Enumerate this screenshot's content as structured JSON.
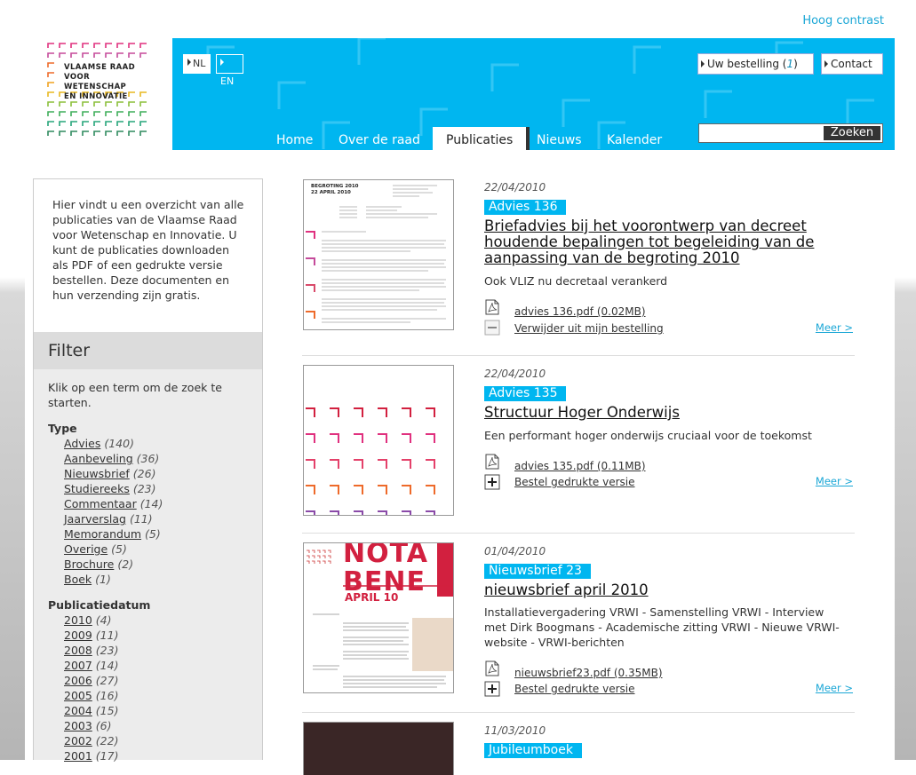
{
  "header": {
    "high_contrast": "Hoog contrast",
    "logo_lines": [
      "VLAAMSE RAAD",
      "VOOR WETENSCHAP",
      "EN INNOVATIE"
    ],
    "lang_nl": "NL",
    "lang_en": "EN",
    "order_label": "Uw bestelling (",
    "order_count": "1",
    "order_close": ")",
    "contact_label": "Contact",
    "nav": [
      "Home",
      "Over de raad",
      "Publicaties",
      "Nieuws",
      "Kalender"
    ],
    "search_button": "Zoeken",
    "search_value": ""
  },
  "sidebar": {
    "intro": "Hier vindt u een overzicht van alle publicaties van de Vlaamse Raad voor Wetenschap en Innovatie. U kunt de publicaties downloaden als PDF of een gedrukte versie bestellen. Deze documenten en hun verzending zijn gratis.",
    "filter_title": "Filter",
    "filter_intro": "Klik op een term om de zoek te starten.",
    "type_title": "Type",
    "types": [
      {
        "label": "Advies",
        "count": "(140)"
      },
      {
        "label": "Aanbeveling",
        "count": "(36)"
      },
      {
        "label": "Nieuwsbrief",
        "count": "(26)"
      },
      {
        "label": "Studiereeks",
        "count": "(23)"
      },
      {
        "label": "Commentaar",
        "count": "(14)"
      },
      {
        "label": "Jaarverslag",
        "count": "(11)"
      },
      {
        "label": "Memorandum",
        "count": "(5)"
      },
      {
        "label": "Overige",
        "count": "(5)"
      },
      {
        "label": "Brochure",
        "count": "(2)"
      },
      {
        "label": "Boek",
        "count": "(1)"
      }
    ],
    "date_title": "Publicatiedatum",
    "dates": [
      {
        "label": "2010",
        "count": "(4)"
      },
      {
        "label": "2009",
        "count": "(11)"
      },
      {
        "label": "2008",
        "count": "(23)"
      },
      {
        "label": "2007",
        "count": "(14)"
      },
      {
        "label": "2006",
        "count": "(27)"
      },
      {
        "label": "2005",
        "count": "(16)"
      },
      {
        "label": "2004",
        "count": "(15)"
      },
      {
        "label": "2003",
        "count": "(6)"
      },
      {
        "label": "2002",
        "count": "(22)"
      },
      {
        "label": "2001",
        "count": "(17)"
      }
    ]
  },
  "publications": [
    {
      "date": "22/04/2010",
      "badge": "Advies 136",
      "title": "Briefadvies bij het voorontwerp van decreet houdende bepalingen tot begeleiding van de aanpassing van de begroting 2010",
      "desc": "Ook VLIZ nu decretaal verankerd",
      "file": "advies 136.pdf (0.02MB)",
      "action": "Verwijder uit mijn bestelling",
      "action_icon": "minus-icon",
      "more": "Meer >",
      "thumb_heading": "BEGROTING 2010\n22 APRIL 2010"
    },
    {
      "date": "22/04/2010",
      "badge": "Advies 135",
      "title": "Structuur Hoger Onderwijs",
      "desc": "Een performant hoger onderwijs cruciaal voor de toekomst",
      "file": "advies 135.pdf (0.11MB)",
      "action": "Bestel gedrukte versie",
      "action_icon": "plus-icon",
      "more": "Meer >"
    },
    {
      "date": "01/04/2010",
      "badge": "Nieuwsbrief 23",
      "title": "nieuwsbrief april 2010",
      "desc": "Installatievergadering VRWI - Samenstelling VRWI - Interview met Dirk Boogmans - Academische zitting VRWI - Nieuwe VRWI-website - VRWI-berichten",
      "file": "nieuwsbrief23.pdf (0.35MB)",
      "action": "Bestel gedrukte versie",
      "action_icon": "plus-icon",
      "more": "Meer >",
      "thumb_heading": "NOTA BENE",
      "thumb_sub": "APRIL 10"
    },
    {
      "date": "11/03/2010",
      "badge": "Jubileumboek"
    }
  ],
  "colors": {
    "accent": "#00b6f0",
    "link": "#1ba7d6",
    "sidebar_bg": "#ececec"
  }
}
